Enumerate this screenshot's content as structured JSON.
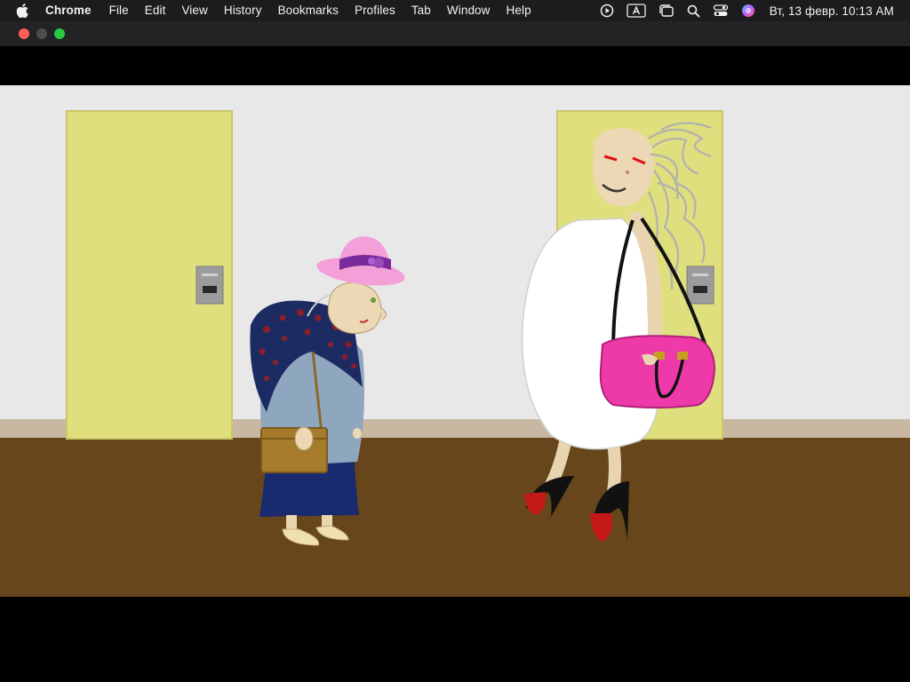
{
  "menubar": {
    "apple_icon": "apple-logo-icon",
    "app_name": "Chrome",
    "items": [
      "File",
      "Edit",
      "View",
      "History",
      "Bookmarks",
      "Profiles",
      "Tab",
      "Window",
      "Help"
    ],
    "status_icons": [
      "play-circle-icon",
      "keyboard-a-icon",
      "window-stack-icon",
      "search-icon",
      "control-center-icon",
      "siri-icon"
    ],
    "clock": "Вт, 13 февр.  10:13 AM"
  },
  "window": {
    "traffic_lights": [
      "close",
      "minimize",
      "maximize"
    ]
  },
  "scene": {
    "wall_color": "#e8e8e8",
    "floor_color": "#66461a",
    "door_color": "#e0df7e",
    "characters": [
      "old-woman-with-hat",
      "tall-woman-with-pink-bag"
    ]
  }
}
